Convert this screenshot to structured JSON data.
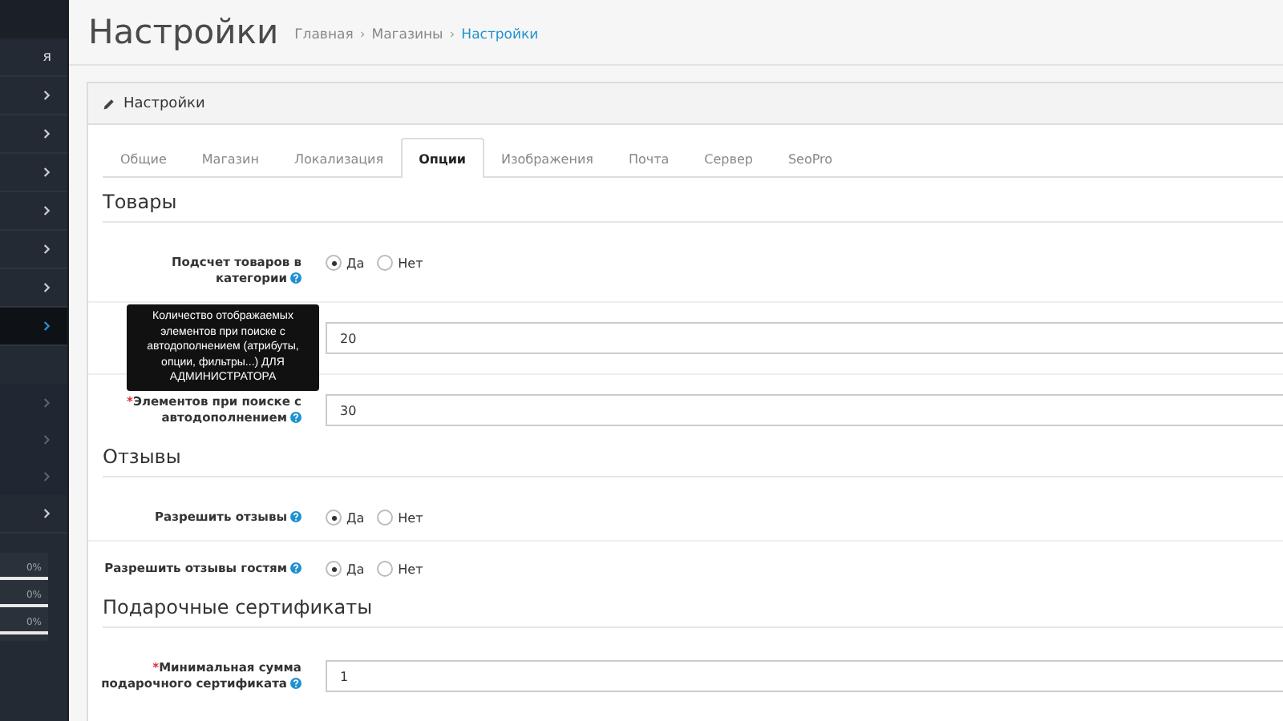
{
  "sidebar": {
    "items": [
      {
        "kind": "label",
        "label": "я",
        "selected": false
      },
      {
        "kind": "menu",
        "selected": false
      },
      {
        "kind": "menu",
        "selected": false
      },
      {
        "kind": "menu",
        "selected": false
      },
      {
        "kind": "menu",
        "selected": false
      },
      {
        "kind": "menu",
        "selected": false
      },
      {
        "kind": "menu",
        "selected": false
      },
      {
        "kind": "menu",
        "selected": true
      },
      {
        "kind": "submenu",
        "selected": false
      },
      {
        "kind": "submenu",
        "selected": false
      },
      {
        "kind": "submenu",
        "selected": false
      },
      {
        "kind": "menu",
        "selected": false
      }
    ],
    "progress": [
      {
        "label": "0%",
        "level": 0
      },
      {
        "label": "0%",
        "level": 0
      },
      {
        "label": "0%",
        "level": 0
      }
    ]
  },
  "page": {
    "title": "Настройки",
    "breadcrumb": [
      {
        "label": "Главная",
        "current": false
      },
      {
        "label": "Магазины",
        "current": false
      },
      {
        "label": "Настройки",
        "current": true
      }
    ],
    "separator": "›"
  },
  "panel": {
    "title": "Настройки",
    "tabs": [
      {
        "label": "Общие",
        "selected": false
      },
      {
        "label": "Магазин",
        "selected": false
      },
      {
        "label": "Локализация",
        "selected": false
      },
      {
        "label": "Опции",
        "selected": true
      },
      {
        "label": "Изображения",
        "selected": false
      },
      {
        "label": "Почта",
        "selected": false
      },
      {
        "label": "Сервер",
        "selected": false
      },
      {
        "label": "SeoPro",
        "selected": false
      }
    ],
    "sections": [
      {
        "heading": "Товары",
        "fields": [
          {
            "kind": "radio",
            "label": "Подсчет товаров в категории",
            "help": true,
            "options": [
              {
                "label": "Да",
                "selected": true
              },
              {
                "label": "Нет",
                "selected": false
              }
            ]
          },
          {
            "kind": "input",
            "value": "20",
            "tooltip": "Количество отображаемых элементов при поиске с автодополнением (атрибуты, опции, фильтры...) ДЛЯ АДМИНИСТРАТОРА"
          },
          {
            "kind": "input",
            "marker": "*",
            "label": "Элементов при поиске с автодополнением",
            "help": true,
            "value": "30"
          }
        ]
      },
      {
        "heading": "Отзывы",
        "fields": [
          {
            "kind": "radio",
            "label": "Разрешить отзывы",
            "help": true,
            "options": [
              {
                "label": "Да",
                "selected": true
              },
              {
                "label": "Нет",
                "selected": false
              }
            ]
          },
          {
            "kind": "radio",
            "label": "Разрешить отзывы гостям",
            "help": true,
            "options": [
              {
                "label": "Да",
                "selected": true
              },
              {
                "label": "Нет",
                "selected": false
              }
            ]
          }
        ]
      },
      {
        "heading": "Подарочные сертификаты",
        "fields": [
          {
            "kind": "input",
            "marker": "*",
            "label": "Минимальная сумма подарочного сертификата",
            "help": true,
            "value": "1"
          }
        ]
      }
    ]
  }
}
